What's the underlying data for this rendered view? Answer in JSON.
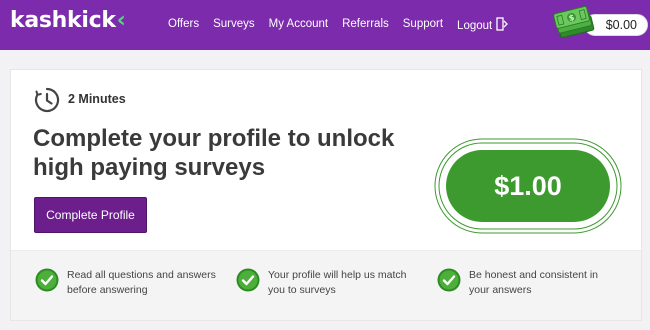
{
  "header": {
    "logo_text": "kashkick",
    "logo_chevron": "‹",
    "nav": [
      "Offers",
      "Surveys",
      "My Account",
      "Referrals",
      "Support",
      "Logout"
    ],
    "balance": "$0.00"
  },
  "offer": {
    "duration": "2 Minutes",
    "headline_line1": "Complete your profile to unlock",
    "headline_line2": "high paying surveys",
    "cta_label": "Complete Profile",
    "reward": "$1.00"
  },
  "tips": [
    {
      "line1": "Read all questions and answers",
      "line2": "before answering"
    },
    {
      "line1": "Your profile will help us match",
      "line2": "you to surveys"
    },
    {
      "line1": "Be honest and consistent in",
      "line2": "your answers"
    }
  ],
  "colors": {
    "brand_purple": "#7b2bab",
    "cta_purple": "#6c1f8c",
    "reward_green": "#3c9a2e",
    "check_green": "#43a033"
  }
}
